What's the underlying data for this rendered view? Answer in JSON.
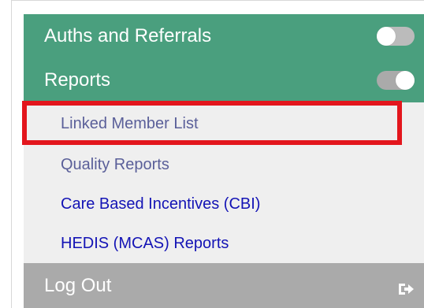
{
  "menu": {
    "auths_and_referrals": {
      "label": "Auths and Referrals",
      "toggle_state": "off"
    },
    "reports": {
      "label": "Reports",
      "toggle_state": "on",
      "items": [
        {
          "label": "Linked Member List",
          "highlighted": true
        },
        {
          "label": "Quality Reports"
        },
        {
          "label": "Care Based Incentives (CBI)"
        },
        {
          "label": "HEDIS (MCAS) Reports"
        }
      ]
    },
    "logout": {
      "label": "Log Out",
      "icon": "sign-out-icon"
    }
  },
  "colors": {
    "header_green": "#4a9f7e",
    "submenu_bg": "#efefef",
    "visited_link": "#5a5f99",
    "link_blue": "#1313b5",
    "logout_gray": "#aaaaaa",
    "highlight_red": "#e3161d"
  }
}
